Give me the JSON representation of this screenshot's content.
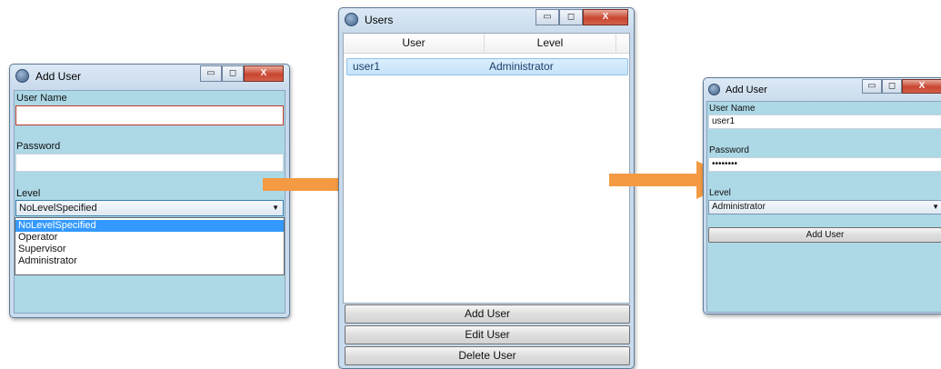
{
  "window1": {
    "title": "Add User",
    "user_name_label": "User Name",
    "password_label": "Password",
    "level_label": "Level",
    "level_selected": "NoLevelSpecified",
    "level_options": [
      "NoLevelSpecified",
      "Operator",
      "Supervisor",
      "Administrator"
    ]
  },
  "window2": {
    "title": "Users",
    "columns": [
      "User",
      "Level"
    ],
    "rows": [
      {
        "user": "user1",
        "level": "Administrator"
      }
    ],
    "add_button": "Add User",
    "edit_button": "Edit User",
    "delete_button": "Delete User"
  },
  "window3": {
    "title": "Add User",
    "user_name_label": "User Name",
    "user_name_value": "user1",
    "password_label": "Password",
    "password_value": "••••••••",
    "level_label": "Level",
    "level_selected": "Administrator",
    "add_button": "Add User"
  },
  "window_controls": {
    "minimize": "▭",
    "maximize": "◻",
    "close": "X"
  },
  "colors": {
    "arrow": "#f39a42",
    "client_bg": "#add8e6",
    "selected": "#3399ff"
  },
  "icons": [
    "app-icon",
    "dropdown-arrow-icon",
    "flow-arrow-icon"
  ]
}
